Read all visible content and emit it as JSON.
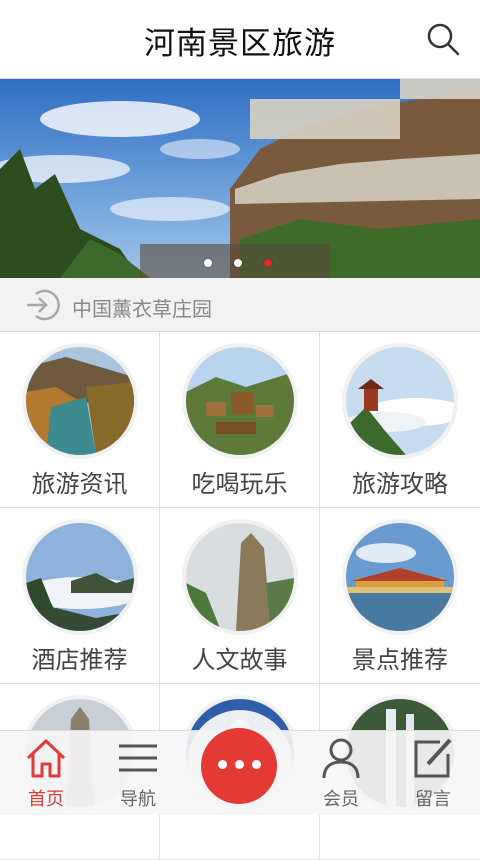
{
  "header": {
    "title": "河南景区旅游",
    "search_icon": "search-icon"
  },
  "banner": {
    "slides": 3,
    "active_slide": 3
  },
  "notice": {
    "icon": "login-arrow-icon",
    "text": "中国薰衣草庄园"
  },
  "grid": {
    "items": [
      {
        "label": "旅游资讯"
      },
      {
        "label": "吃喝玩乐"
      },
      {
        "label": "旅游攻略"
      },
      {
        "label": "酒店推荐"
      },
      {
        "label": "人文故事"
      },
      {
        "label": "景点推荐"
      },
      {
        "label": ""
      },
      {
        "label": ""
      },
      {
        "label": ""
      }
    ]
  },
  "tabbar": {
    "items": [
      {
        "label": "首页",
        "icon": "home-icon",
        "active": true
      },
      {
        "label": "导航",
        "icon": "menu-icon",
        "active": false
      },
      {
        "label": "",
        "icon": "more-icon",
        "active": false
      },
      {
        "label": "会员",
        "icon": "user-icon",
        "active": false
      },
      {
        "label": "留言",
        "icon": "edit-icon",
        "active": false
      }
    ]
  },
  "colors": {
    "accent": "#e53935",
    "active_tab": "#e23a3a",
    "notice_bg": "#f2f2f2"
  }
}
